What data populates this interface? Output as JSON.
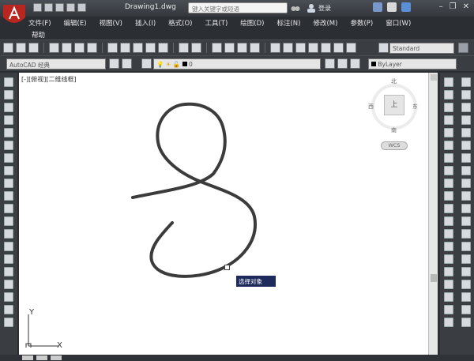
{
  "title_bar": {
    "document_title": "Drawing1.dwg",
    "search_placeholder": "键入关键字或短语",
    "login_label": "登录"
  },
  "menu": {
    "items": [
      "文件(F)",
      "编辑(E)",
      "视图(V)",
      "插入(I)",
      "格式(O)",
      "工具(T)",
      "绘图(D)",
      "标注(N)",
      "修改(M)",
      "参数(P)",
      "窗口(W)"
    ],
    "help": "帮助"
  },
  "toolbar": {
    "workspace": "AutoCAD 经典",
    "text_style": "Standard",
    "layer_value": "0",
    "color_value": "ByLayer"
  },
  "canvas": {
    "viewport_label": "[-][俯视][二维线框]",
    "tooltip": "选择对象"
  },
  "viewcube": {
    "north": "北",
    "south": "南",
    "east": "东",
    "west": "西",
    "top_face": "上",
    "wcs": "WCS"
  },
  "ucs": {
    "x_label": "X",
    "y_label": "Y"
  },
  "colors": {
    "canvas": "#ffffff",
    "chrome": "#3a3d42",
    "curve": "#3b3b3b",
    "tooltip_bg": "#1d2a5c"
  }
}
